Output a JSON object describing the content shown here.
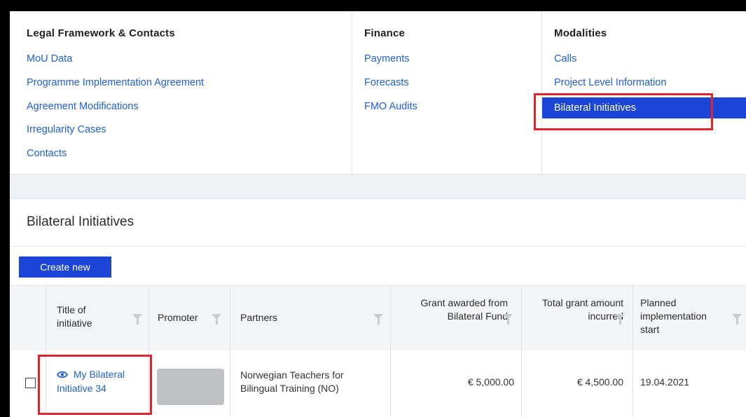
{
  "menu": {
    "columns": [
      {
        "heading": "Legal Framework & Contacts",
        "items": [
          "MoU Data",
          "Programme Implementation Agreement",
          "Agreement Modifications",
          "Irregularity Cases",
          "Contacts"
        ]
      },
      {
        "heading": "Finance",
        "items": [
          "Payments",
          "Forecasts",
          "FMO Audits"
        ]
      },
      {
        "heading": "Modalities",
        "items": [
          "Calls",
          "Project Level Information",
          "Bilateral Initiatives"
        ],
        "active_index": 2
      }
    ]
  },
  "section": {
    "title": "Bilateral Initiatives",
    "create_button": "Create new"
  },
  "table": {
    "columns": [
      "Title of initiative",
      "Promoter",
      "Partners",
      "Grant awarded from Bilateral Fund",
      "Total grant amount incurred",
      "Planned implementation start"
    ],
    "rows": [
      {
        "title": "My Bilateral Initiative 34",
        "promoter": "",
        "partners": "Norwegian Teachers for Bilingual Training (NO)",
        "grant_awarded": "€ 5,000.00",
        "total_incurred": "€ 4,500.00",
        "planned_start": "19.04.2021"
      }
    ]
  },
  "colors": {
    "link": "#1f5fd6",
    "primary": "#1a45d6",
    "highlight": "#e0242f"
  }
}
